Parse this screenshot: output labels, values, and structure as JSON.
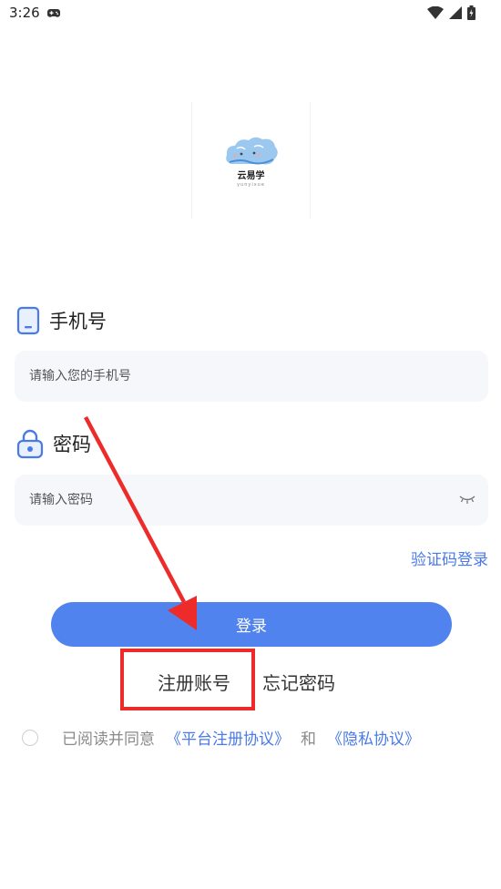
{
  "status_bar": {
    "time": "3:26"
  },
  "logo": {
    "name": "云易学",
    "subtitle": "yunyixue"
  },
  "phone": {
    "label": "手机号",
    "placeholder": "请输入您的手机号",
    "value": ""
  },
  "password": {
    "label": "密码",
    "placeholder": "请输入密码",
    "value": ""
  },
  "sms_login_label": "验证码登录",
  "login_label": "登录",
  "register_label": "注册账号",
  "forgot_label": "忘记密码",
  "agreement": {
    "prefix": "已阅读并同意",
    "platform": "《平台注册协议》",
    "and": "和",
    "privacy": "《隐私协议》"
  },
  "colors": {
    "accent": "#4a7ae8",
    "button": "#5083ee",
    "annotation": "#ee2b2b",
    "input_bg": "#f6f7fb"
  }
}
